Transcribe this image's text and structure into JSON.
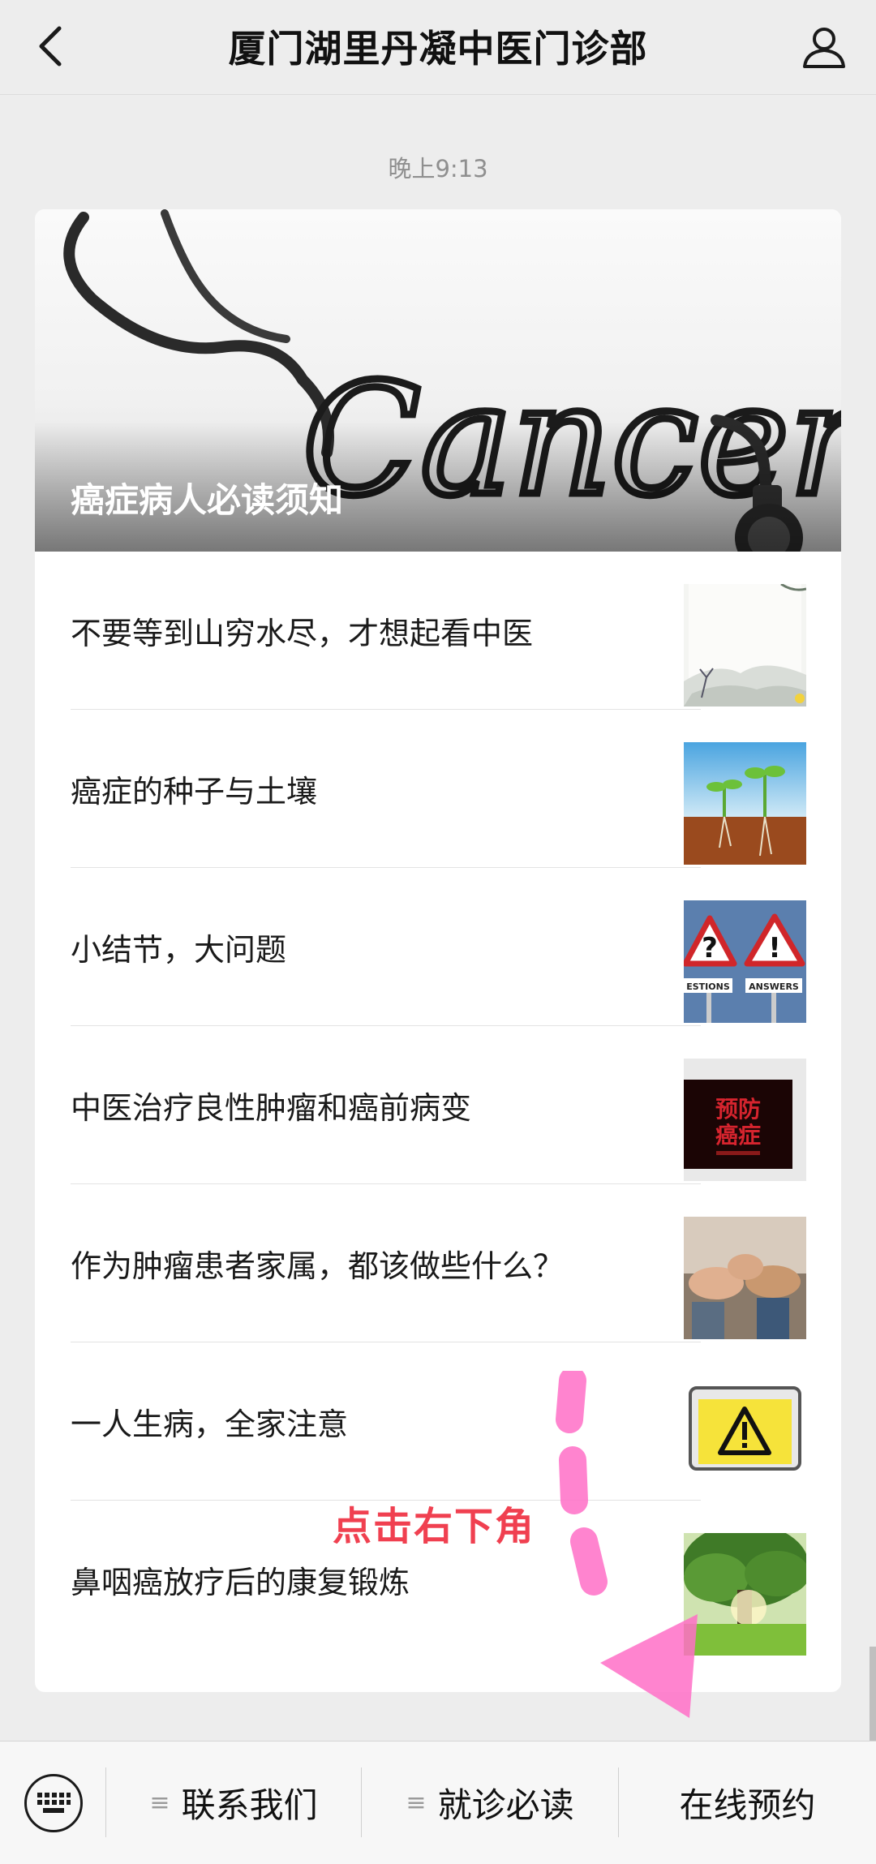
{
  "header": {
    "title": "厦门湖里丹凝中医门诊部",
    "back_icon": "chevron-left-icon",
    "profile_icon": "person-icon"
  },
  "timestamp": "晚上9:13",
  "cover": {
    "title": "癌症病人必读须知",
    "image_word": "Cancer"
  },
  "articles": [
    {
      "title": "不要等到山穷水尽，才想起看中医"
    },
    {
      "title": "癌症的种子与土壤"
    },
    {
      "title": "小结节，大问题"
    },
    {
      "title": "中医治疗良性肿瘤和癌前病变"
    },
    {
      "title": "作为肿瘤患者家属，都该做些什么？"
    },
    {
      "title": "一人生病，全家注意"
    },
    {
      "title": "鼻咽癌放疗后的康复锻炼"
    }
  ],
  "thumbs": {
    "t3_left": "ESTIONS",
    "t3_right": "ANSWERS",
    "t4_line1": "预防",
    "t4_line2": "癌症"
  },
  "annotation": {
    "text": "点击右下角"
  },
  "bottombar": {
    "keyboard_icon": "keyboard-icon",
    "menu1": "联系我们",
    "menu2": "就诊必读",
    "menu3": "在线预约",
    "menu_icon": "≡"
  },
  "colors": {
    "annotation": "#f04050",
    "arrow": "#ff6ec7"
  }
}
